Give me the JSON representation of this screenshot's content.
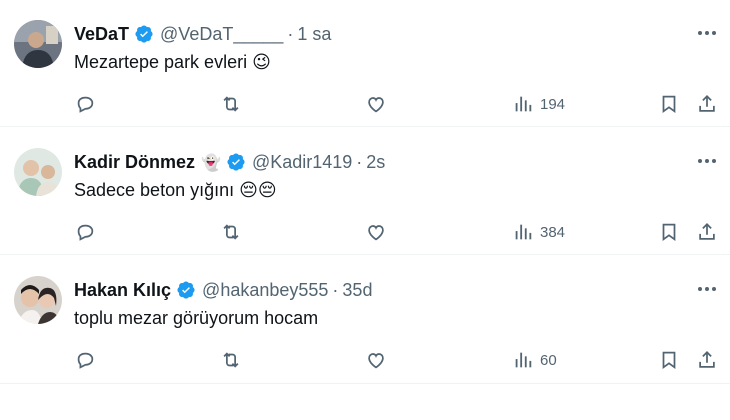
{
  "tweets": [
    {
      "name": "VeDaT",
      "handle": "@VeDaT_____",
      "time": "1 sa",
      "badge_emoji": "",
      "text": "Mezartepe park evleri",
      "text_emoji": "😉",
      "views": "194",
      "avatar_colors": [
        "#4b5560",
        "#c9b8a3"
      ]
    },
    {
      "name": "Kadir Dönmez",
      "handle": "@Kadir1419",
      "time": "2s",
      "badge_emoji": "👻",
      "text": "Sadece beton yığını",
      "text_emoji": "😔😔",
      "views": "384",
      "avatar_colors": [
        "#8fb3a0",
        "#e8d6c8"
      ]
    },
    {
      "name": "Hakan Kılıç",
      "handle": "@hakanbey555",
      "time": "35d",
      "badge_emoji": "",
      "text": "toplu mezar görüyorum hocam",
      "text_emoji": "",
      "views": "60",
      "avatar_colors": [
        "#2d2a2a",
        "#e7c7b0"
      ]
    }
  ],
  "colors": {
    "verified": "#1d9bf0",
    "muted": "#536471",
    "text": "#0f1419",
    "divider": "#eff3f4"
  },
  "icons": [
    "more-icon",
    "reply-icon",
    "retweet-icon",
    "like-icon",
    "views-icon",
    "bookmark-icon",
    "share-icon",
    "verified-badge-icon"
  ]
}
